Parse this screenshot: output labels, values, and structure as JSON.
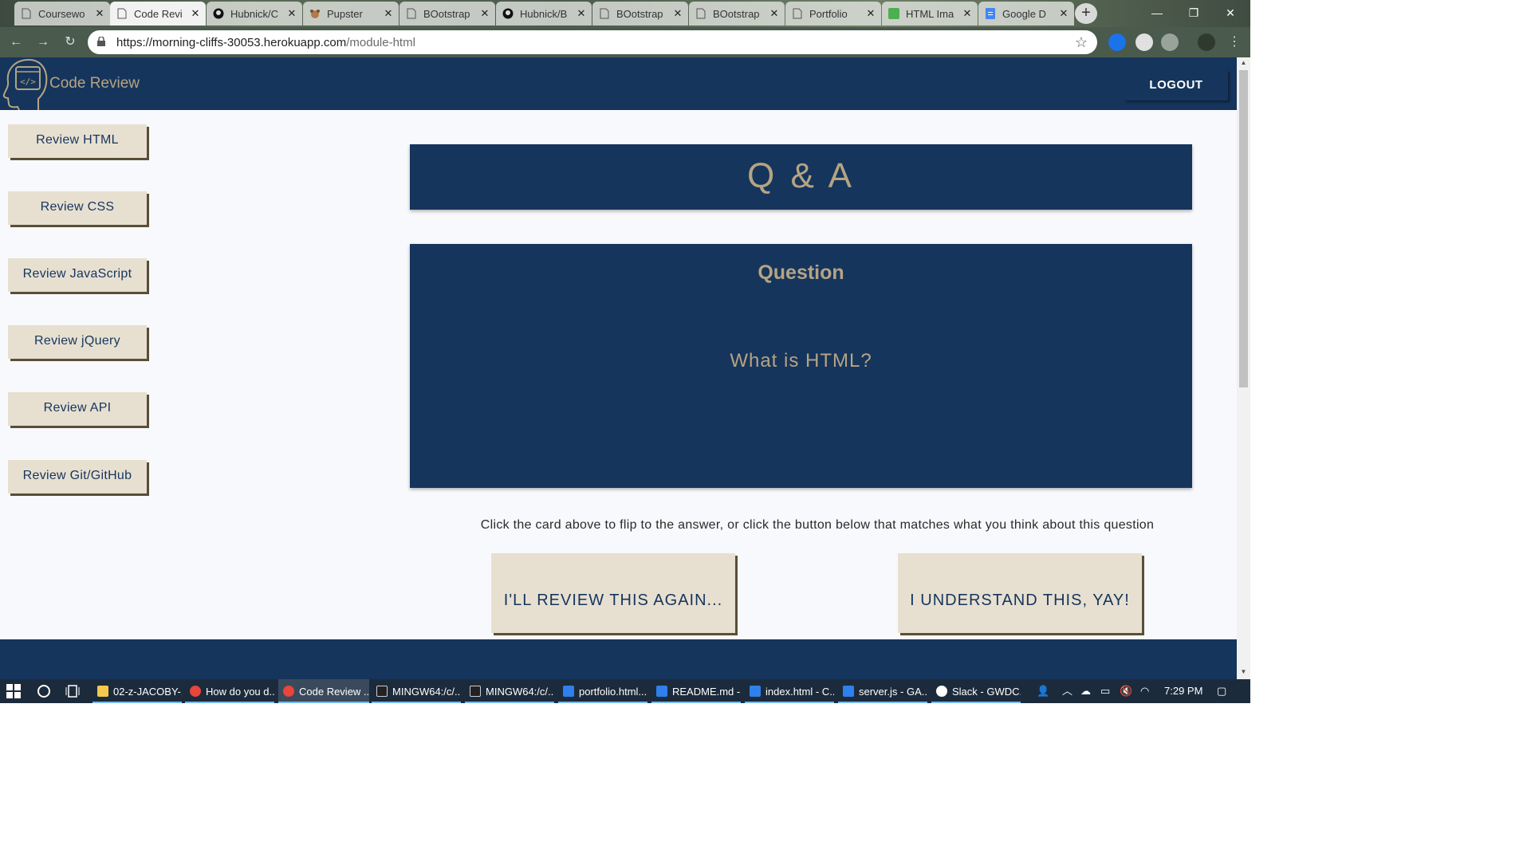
{
  "browser": {
    "tabs": [
      {
        "title": "Coursewo",
        "icon": "page-icon"
      },
      {
        "title": "Code Revi",
        "icon": "page-icon",
        "active": true
      },
      {
        "title": "Hubnick/C",
        "icon": "github-icon"
      },
      {
        "title": "Pupster",
        "icon": "dog-icon"
      },
      {
        "title": "BOotstrap",
        "icon": "page-icon"
      },
      {
        "title": "Hubnick/B",
        "icon": "github-icon"
      },
      {
        "title": "BOotstrap",
        "icon": "page-icon"
      },
      {
        "title": "BOotstrap",
        "icon": "page-icon"
      },
      {
        "title": "Portfolio",
        "icon": "page-icon"
      },
      {
        "title": "HTML Ima",
        "icon": "w3-icon"
      },
      {
        "title": "Google D",
        "icon": "docs-icon"
      }
    ],
    "tab_close_glyph": "✕",
    "new_tab_glyph": "+",
    "url_host": "https://morning-cliffs-30053.herokuapp.com",
    "url_path": "/module-html"
  },
  "site": {
    "brand": "Code Review",
    "logout_label": "LOGOUT",
    "sidebar": [
      {
        "label": "Review HTML"
      },
      {
        "label": "Review CSS"
      },
      {
        "label": "Review JavaScript"
      },
      {
        "label": "Review jQuery"
      },
      {
        "label": "Review API"
      },
      {
        "label": "Review Git/GitHub"
      }
    ],
    "header_title": "Q & A",
    "card": {
      "title": "Question",
      "question": "What is HTML?"
    },
    "instructions": "Click the card above to flip to the answer, or click the button below that matches what you think about this question",
    "review_again_label": "I'LL REVIEW THIS AGAIN...",
    "understand_label": "I UNDERSTAND THIS, YAY!",
    "colors": {
      "navy": "#16355c",
      "gold": "#b5a483",
      "cream": "#e7e0d1"
    }
  },
  "taskbar": {
    "items": [
      {
        "label": "02-z-JACOBY-...",
        "icon": "folder-icon"
      },
      {
        "label": "How do you d...",
        "icon": "chrome-icon"
      },
      {
        "label": "Code Review ...",
        "icon": "chrome-icon",
        "active": true
      },
      {
        "label": "MINGW64:/c/...",
        "icon": "terminal-icon"
      },
      {
        "label": "MINGW64:/c/...",
        "icon": "terminal-icon"
      },
      {
        "label": "portfolio.html...",
        "icon": "vscode-icon"
      },
      {
        "label": "README.md -...",
        "icon": "vscode-icon"
      },
      {
        "label": "index.html - C...",
        "icon": "vscode-icon"
      },
      {
        "label": "server.js - GA...",
        "icon": "vscode-icon"
      },
      {
        "label": "Slack - GWDC...",
        "icon": "slack-icon"
      }
    ],
    "clock": "7:29 PM"
  }
}
